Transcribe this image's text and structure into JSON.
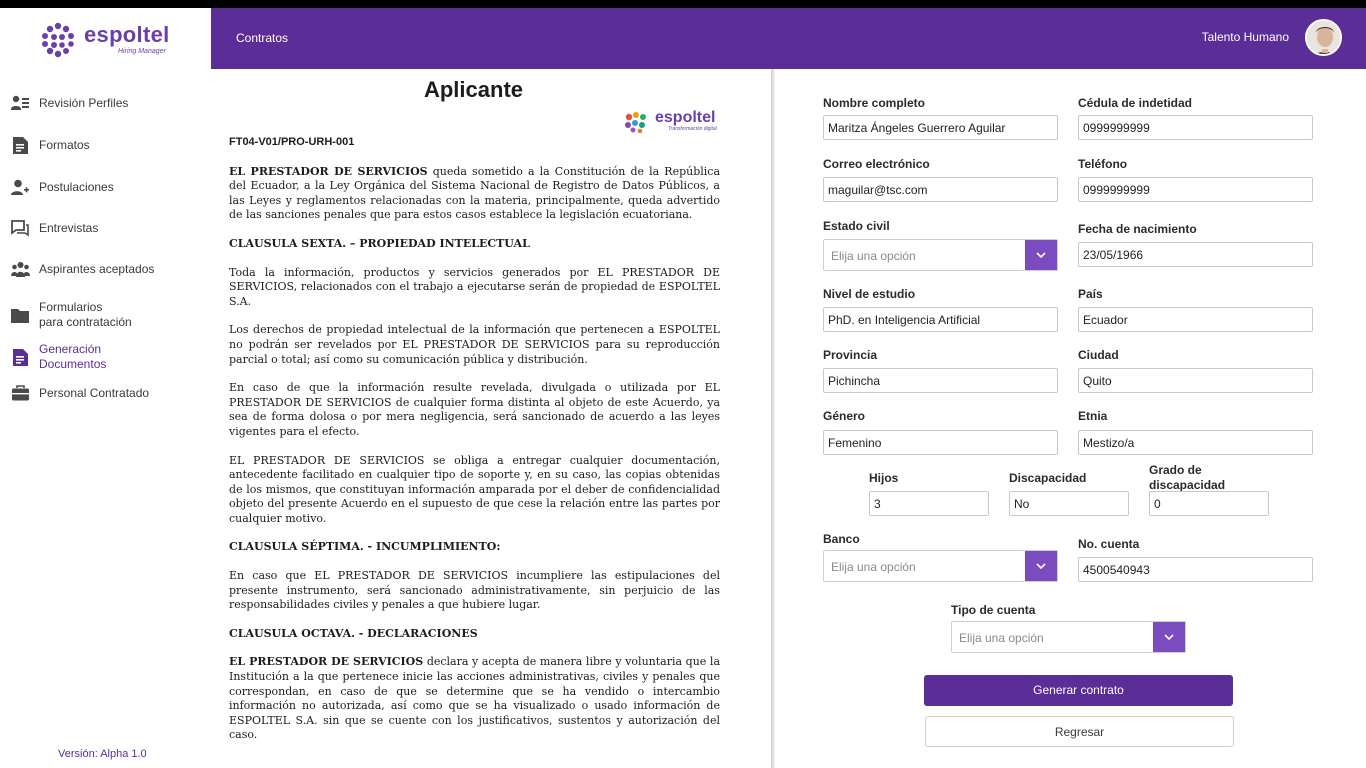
{
  "app": {
    "logo_text": "espoltel",
    "logo_subtitle": "Hiring Manager",
    "version": "Versión: Alpha 1.0"
  },
  "header": {
    "title": "Contratos",
    "user_name": "Talento Humano"
  },
  "sidebar": {
    "items": [
      {
        "label": "Revisión Perfiles",
        "icon": "user-list-icon"
      },
      {
        "label": "Formatos",
        "icon": "document-icon"
      },
      {
        "label": "Postulaciones",
        "icon": "user-add-icon"
      },
      {
        "label": "Entrevistas",
        "icon": "chat-icon"
      },
      {
        "label": "Aspirantes aceptados",
        "icon": "group-icon"
      },
      {
        "label_line1": "Formularios",
        "label_line2": "para contratación",
        "icon": "folder-icon"
      },
      {
        "label_line1": "Generación",
        "label_line2": "Documentos",
        "icon": "document-icon"
      },
      {
        "label": "Personal Contratado",
        "icon": "briefcase-icon"
      }
    ]
  },
  "document": {
    "title": "Aplicante",
    "logo_text": "espoltel",
    "logo_subtitle": "Transformación digital",
    "code": "FT04-V01/PRO-URH-001",
    "paragraphs": [
      {
        "bold_lead": "EL PRESTADOR DE SERVICIOS",
        "text": " queda sometido a la Constitución de la República del Ecuador, a la Ley Orgánica del Sistema Nacional de Registro de Datos Públicos, a las Leyes y reglamentos relacionadas con la materia, principalmente, queda advertido de las sanciones penales que para estos casos establece la legislación ecuatoriana."
      },
      {
        "heading": "CLAUSULA SEXTA. – PROPIEDAD INTELECTUAL"
      },
      {
        "text": "Toda la información, productos y servicios generados por EL PRESTADOR DE SERVICIOS, relacionados con el trabajo a ejecutarse serán de propiedad de ESPOLTEL S.A."
      },
      {
        "text": "Los derechos de propiedad intelectual de la información que pertenecen a ESPOLTEL no podrán ser revelados por EL PRESTADOR DE SERVICIOS para su reproducción parcial o total; así como su comunicación pública y distribución."
      },
      {
        "text": "En caso de que la información resulte revelada, divulgada o utilizada por EL PRESTADOR DE SERVICIOS de cualquier forma distinta al objeto de este Acuerdo, ya sea de forma dolosa o por mera negligencia, será sancionado de acuerdo a las leyes vigentes para el efecto."
      },
      {
        "text": "EL PRESTADOR DE SERVICIOS se obliga a entregar cualquier documentación, antecedente facilitado en cualquier tipo de soporte y, en su caso, las copias obtenidas de los mismos, que constituyan información amparada por el deber de confidencialidad objeto del presente Acuerdo en el supuesto de que cese la relación entre las partes por cualquier motivo."
      },
      {
        "heading": "CLAUSULA SÉPTIMA. - INCUMPLIMIENTO:"
      },
      {
        "text": "En caso que EL PRESTADOR DE SERVICIOS incumpliere las estipulaciones del presente instrumento, será sancionado administrativamente, sin perjuicio de las responsabilidades civiles y penales a que hubiere lugar."
      },
      {
        "heading": "CLAUSULA OCTAVA. - DECLARACIONES"
      },
      {
        "bold_lead": "EL PRESTADOR DE SERVICIOS",
        "text": " declara y acepta de manera libre y voluntaria que la Institución a la que pertenece inicie las acciones administrativas, civiles y penales que correspondan, en caso de que se determine que se ha vendido o intercambio información no autorizada, así como que se ha visualizado o usado información de ESPOLTEL S.A. sin que se cuente con los justificativos, sustentos y autorización del caso."
      }
    ]
  },
  "form": {
    "nombre_label": "Nombre completo",
    "nombre_value": "Maritza Ángeles Guerrero Aguilar",
    "cedula_label": "Cédula de indetidad",
    "cedula_value": "0999999999",
    "correo_label": "Correo electrónico",
    "correo_value": "maguilar@tsc.com",
    "telefono_label": "Teléfono",
    "telefono_value": "0999999999",
    "estado_label": "Estado civil",
    "estado_placeholder": "Elija una opción",
    "fecha_label": "Fecha de nacimiento",
    "fecha_value": "23/05/1966",
    "nivel_label": "Nivel de estudio",
    "nivel_value": "PhD. en Inteligencia Artificial",
    "pais_label": "País",
    "pais_value": "Ecuador",
    "provincia_label": "Provincia",
    "provincia_value": "Pichincha",
    "ciudad_label": "Ciudad",
    "ciudad_value": "Quito",
    "genero_label": "Género",
    "genero_value": "Femenino",
    "etnia_label": "Etnia",
    "etnia_value": "Mestizo/a",
    "hijos_label": "Hijos",
    "hijos_value": "3",
    "discapacidad_label": "Discapacidad",
    "discapacidad_value": "No",
    "grado_label_line1": "Grado de",
    "grado_label_line2": "discapacidad",
    "grado_value": "0",
    "banco_label": "Banco",
    "banco_placeholder": "Elija una opción",
    "cuenta_label": "No. cuenta",
    "cuenta_value": "4500540943",
    "tipo_label": "Tipo de cuenta",
    "tipo_placeholder": "Elija una opción",
    "generate_button": "Generar contrato",
    "back_button": "Regresar"
  },
  "colors": {
    "brand_purple": "#5b2d96",
    "accent_purple": "#7b4cbf"
  }
}
